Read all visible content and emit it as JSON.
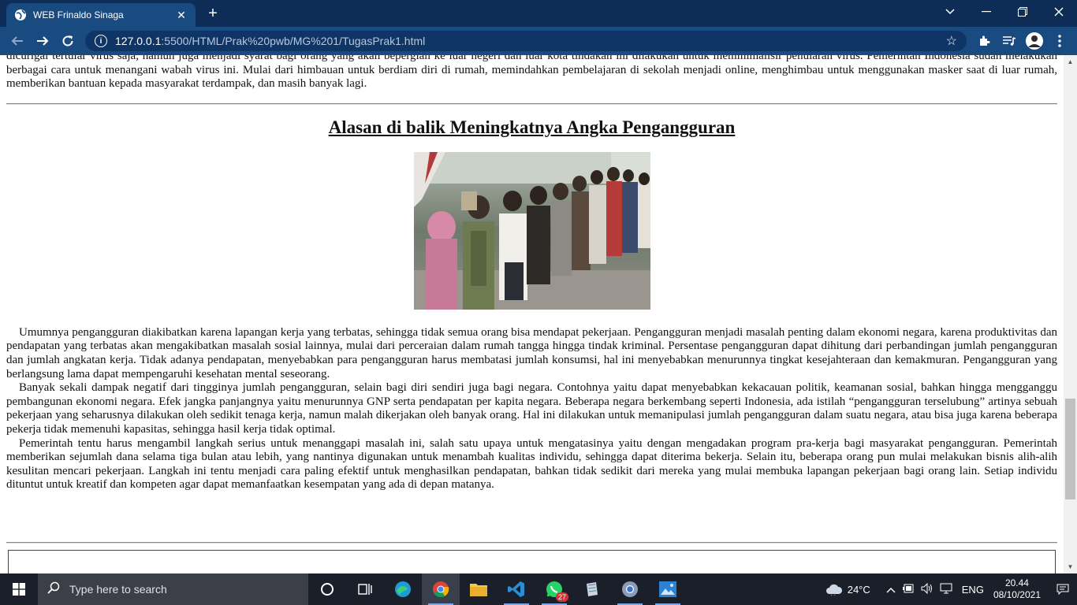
{
  "browser": {
    "tab_title": "WEB Frinaldo Sinaga",
    "url_host": "127.0.0.1",
    "url_path": ":5500/HTML/Prak%20pwb/MG%201/TugasPrak1.html"
  },
  "page": {
    "top_paragraph": "dicurigai tertular virus saja, namun juga menjadi syarat bagi orang yang akan bepergian ke luar negeri dan luar kota tindakan ini dilakukan untuk meminimalisir penularan virus. Pemerintah Indonesia sudah melakukan berbagai cara untuk menangani wabah virus ini. Mulai dari himbauan untuk berdiam diri di rumah, memindahkan pembelajaran di sekolah menjadi online, menghimbau untuk menggunakan masker saat di luar rumah, memberikan bantuan kepada masyarakat terdampak, dan masih banyak lagi.",
    "heading": "Alasan di balik Meningkatnya Angka Pengangguran",
    "paragraphs": [
      "Umumnya pengangguran diakibatkan karena lapangan kerja yang terbatas, sehingga tidak semua orang bisa mendapat pekerjaan. Pengangguran menjadi masalah penting dalam ekonomi negara, karena produktivitas dan pendapatan yang terbatas akan mengakibatkan masalah sosial lainnya, mulai dari perceraian dalam rumah tangga hingga tindak kriminal. Persentase pengangguran dapat dihitung dari perbandingan jumlah pengangguran dan jumlah angkatan kerja. Tidak adanya pendapatan, menyebabkan para pengangguran harus membatasi jumlah konsumsi, hal ini menyebabkan menurunnya tingkat kesejahteraan dan kemakmuran. Pengangguran yang berlangsung lama dapat mempengaruhi kesehatan mental seseorang.",
      "Banyak sekali dampak negatif dari tingginya jumlah pengangguran, selain bagi diri sendiri juga bagi negara. Contohnya yaitu dapat menyebabkan kekacauan politik, keamanan sosial, bahkan hingga mengganggu pembangunan ekonomi negara. Efek jangka panjangnya yaitu menurunnya GNP serta pendapatan per kapita negara. Beberapa negara berkembang seperti Indonesia, ada istilah “pengangguran terselubung” artinya sebuah pekerjaan yang seharusnya dilakukan oleh sedikit tenaga kerja, namun malah dikerjakan oleh banyak orang. Hal ini dilakukan untuk memanipulasi jumlah pengangguran dalam suatu negara, atau bisa juga karena beberapa pekerja tidak memenuhi kapasitas, sehingga hasil kerja tidak optimal.",
      "Pemerintah tentu harus mengambil langkah serius untuk menanggapi masalah ini, salah satu upaya untuk mengatasinya yaitu dengan mengadakan program pra-kerja bagi masyarakat pengangguran. Pemerintah memberikan sejumlah dana selama tiga bulan atau lebih, yang nantinya digunakan untuk menambah kualitas individu, sehingga dapat diterima bekerja. Selain itu, beberapa orang pun mulai melakukan bisnis alih-alih kesulitan mencari pekerjaan. Langkah ini tentu menjadi cara paling efektif untuk menghasilkan pendapatan, bahkan tidak sedikit dari mereka yang mulai membuka lapangan pekerjaan bagi orang lain. Setiap individu dituntut untuk kreatif dan kompeten agar dapat memanfaatkan kesempatan yang ada di depan matanya."
    ]
  },
  "taskbar": {
    "search_placeholder": "Type here to search",
    "whatsapp_badge": "27",
    "weather": "24°C",
    "language": "ENG",
    "time": "20.44",
    "date": "08/10/2021"
  },
  "colors": {
    "titlebar": "#0d2d57",
    "toolbar": "#1a4b80",
    "taskbar": "#1b1f2a"
  }
}
